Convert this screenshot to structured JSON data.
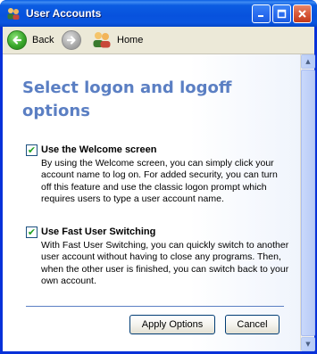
{
  "window": {
    "title": "User Accounts"
  },
  "toolbar": {
    "back_label": "Back",
    "home_label": "Home"
  },
  "page": {
    "heading": "Select logon and logoff options"
  },
  "options": {
    "welcome": {
      "label": "Use the Welcome screen",
      "checked": true,
      "description": "By using the Welcome screen, you can simply click your account name to log on. For added security, you can turn off this feature and use the classic logon prompt which requires users to type a user account name."
    },
    "fast_switching": {
      "label": "Use Fast User Switching",
      "checked": true,
      "description": "With Fast User Switching, you can quickly switch to another user account without having to close any programs. Then, when the other user is finished, you can switch back to your own account."
    }
  },
  "buttons": {
    "apply": "Apply Options",
    "cancel": "Cancel"
  }
}
